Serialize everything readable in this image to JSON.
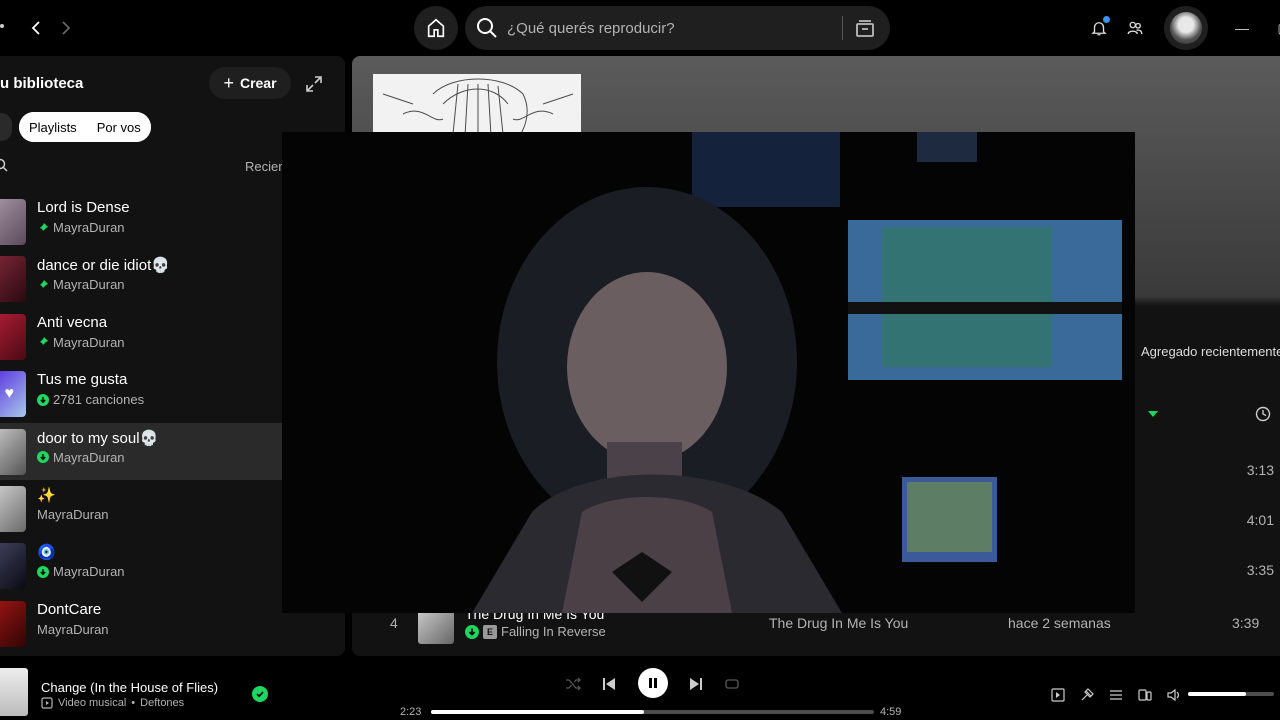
{
  "topbar": {
    "search_placeholder": "¿Qué querés reproducir?"
  },
  "sidebar": {
    "title": "u biblioteca",
    "create_label": "Crear",
    "chips": [
      "Playlists",
      "Por vos"
    ],
    "sort_label": "Recien",
    "items": [
      {
        "name": "Lord is Dense",
        "sub": "MayraDuran",
        "marker": "pin",
        "thumb_color": "#8a7a8a"
      },
      {
        "name": "dance or die idiot💀",
        "sub": "MayraDuran",
        "marker": "pin",
        "thumb_color": "#6b1e2b"
      },
      {
        "name": "Anti vecna",
        "sub": "MayraDuran",
        "marker": "pin",
        "thumb_color": "#9a1b2e"
      },
      {
        "name": "Tus me gusta",
        "sub": "2781 canciones",
        "marker": "download",
        "thumb_color": "#6d3cf0"
      },
      {
        "name": "door to my soul💀",
        "sub": "MayraDuran",
        "marker": "download",
        "thumb_color": "#9a9a9a"
      },
      {
        "name": "✨",
        "sub": "MayraDuran",
        "marker": "none",
        "thumb_color": "#bdbdbd"
      },
      {
        "name": "🧿",
        "sub": "MayraDuran",
        "marker": "download",
        "thumb_color": "#2d2d3d"
      },
      {
        "name": "DontCare",
        "sub": "MayraDuran",
        "marker": "none",
        "thumb_color": "#7a1010"
      }
    ]
  },
  "main": {
    "added_label": "Agregado recientemente",
    "durations": [
      "3:13",
      "4:01",
      "3:35"
    ],
    "track": {
      "number": "4",
      "title": "The Drug In Me Is You",
      "explicit": "E",
      "artist": "Falling In Reverse",
      "album": "The Drug In Me Is You",
      "added": "hace 2 semanas",
      "duration": "3:39"
    }
  },
  "player": {
    "title": "Change (In the House of Flies)",
    "sub_type": "Video musical",
    "sub_sep": "•",
    "artist": "Deftones",
    "elapsed": "2:23",
    "total": "4:59",
    "progress": 0.48,
    "volume": 0.68
  },
  "colors": {
    "accent": "#1ed760",
    "background": "#121212"
  }
}
